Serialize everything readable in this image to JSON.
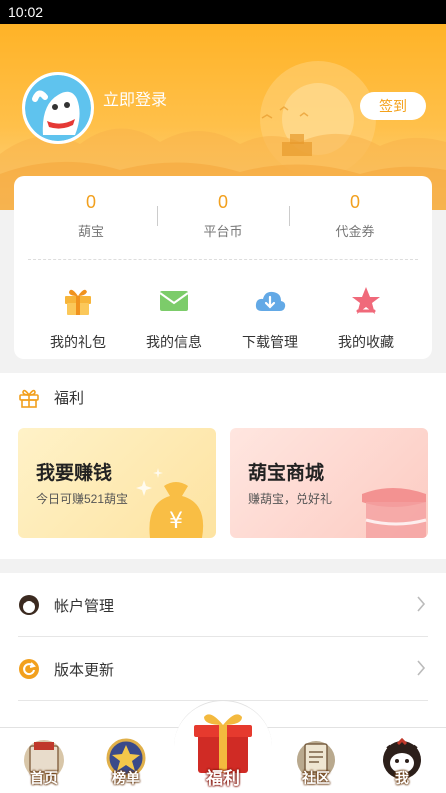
{
  "status_bar": {
    "time": "10:02"
  },
  "header": {
    "login_text": "立即登录",
    "signin_label": "签到"
  },
  "stats": [
    {
      "value": "0",
      "label": "葫宝"
    },
    {
      "value": "0",
      "label": "平台币"
    },
    {
      "value": "0",
      "label": "代金券"
    }
  ],
  "quick_actions": [
    {
      "label": "我的礼包",
      "icon": "gift-icon"
    },
    {
      "label": "我的信息",
      "icon": "envelope-icon"
    },
    {
      "label": "下载管理",
      "icon": "cloud-download-icon"
    },
    {
      "label": "我的收藏",
      "icon": "star-icon"
    }
  ],
  "welfare": {
    "title": "福利",
    "earn": {
      "title": "我要赚钱",
      "subtitle": "今日可赚521葫宝"
    },
    "mall": {
      "title": "葫宝商城",
      "subtitle": "赚葫宝，兑好礼"
    }
  },
  "menu": [
    {
      "label": "帐户管理",
      "icon": "account-icon"
    },
    {
      "label": "版本更新",
      "icon": "update-icon"
    }
  ],
  "tabbar": [
    {
      "label": "首页",
      "icon": "home-icon"
    },
    {
      "label": "榜单",
      "icon": "ranking-icon"
    },
    {
      "label": "福利",
      "icon": "gift-box-icon"
    },
    {
      "label": "社区",
      "icon": "community-icon"
    },
    {
      "label": "我",
      "icon": "me-icon"
    }
  ],
  "colors": {
    "accent": "#f2a01e",
    "header": "#ffb327"
  }
}
